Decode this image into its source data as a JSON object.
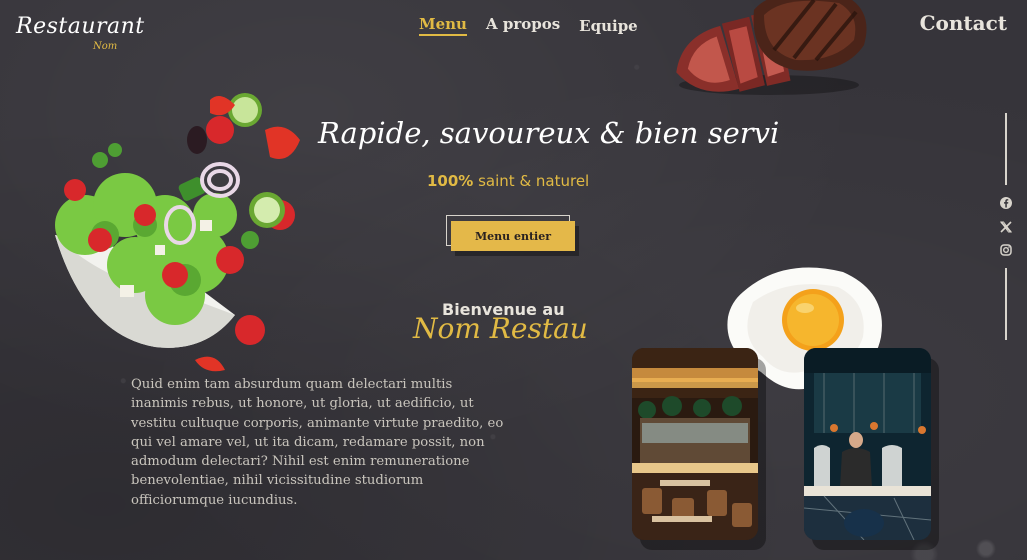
{
  "brand": {
    "name": "Restaurant",
    "sub": "Nom"
  },
  "nav": {
    "items": [
      {
        "label": "Menu",
        "active": true
      },
      {
        "label": "A propos",
        "active": false
      },
      {
        "label": "Equipe",
        "active": false
      }
    ],
    "contact": "Contact"
  },
  "hero": {
    "title": "Rapide, savoureux & bien servi",
    "subtitle_strong": "100%",
    "subtitle_rest": " saint & naturel",
    "button": "Menu entier"
  },
  "welcome": {
    "line1": "Bienvenue au",
    "line2": "Nom Restau",
    "paragraph": "Quid enim tam absurdum quam delectari multis inanimis rebus, ut honore, ut gloria, ut aedificio, ut vestitu cultuque corporis, animante virtute praedito, eo qui vel amare vel, ut ita dicam, redamare possit, non admodum delectari? Nihil est enim remuneratione benevolentiae, nihil vicissitudine studiorum officiorumque iucundius."
  },
  "social": [
    "facebook-icon",
    "x-icon",
    "instagram-icon"
  ],
  "colors": {
    "background": "#36343a",
    "accent": "#e1ba44",
    "button": "#e4b849",
    "text": "#e8e4dc"
  }
}
